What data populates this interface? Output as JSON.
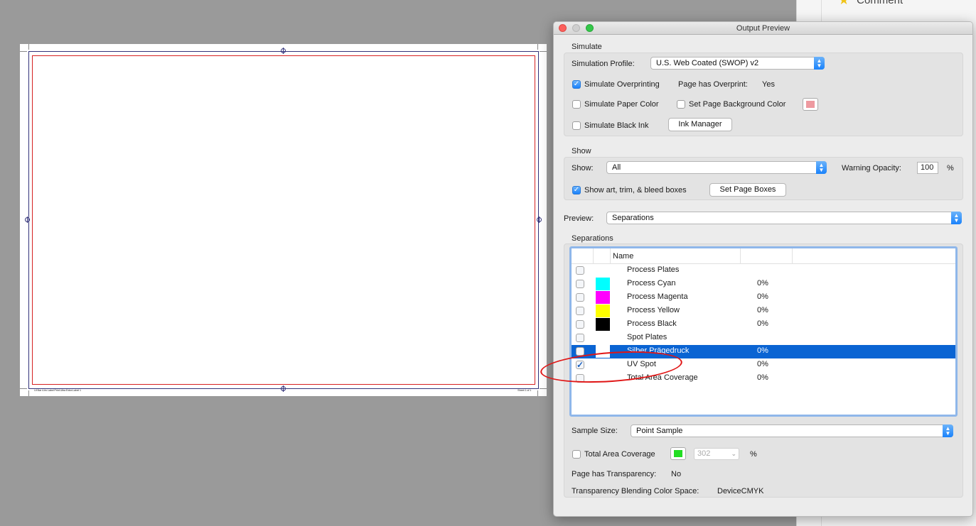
{
  "side_panel": {
    "comment_label": "Comment"
  },
  "page": {
    "slug_left": "UI Bar 4-fw Label Print Ultra Extra Label 1",
    "slug_right": "Sheet 1 of 1"
  },
  "dialog": {
    "title": "Output Preview",
    "simulate": {
      "section_label": "Simulate",
      "profile_label": "Simulation Profile:",
      "profile_value": "U.S. Web Coated (SWOP) v2",
      "overprinting_label": "Simulate Overprinting",
      "overprinting_checked": true,
      "overprint_status_label": "Page has Overprint:",
      "overprint_status_value": "Yes",
      "paper_color_label": "Simulate Paper Color",
      "bg_color_label": "Set Page Background Color",
      "bg_color_swatch": "#ee9aa0",
      "black_ink_label": "Simulate Black Ink",
      "ink_manager_button": "Ink Manager"
    },
    "show": {
      "section_label": "Show",
      "show_label": "Show:",
      "show_value": "All",
      "warning_opacity_label": "Warning Opacity:",
      "warning_opacity_value": "100",
      "percent": "%",
      "boxes_label": "Show art, trim, & bleed boxes",
      "boxes_checked": true,
      "set_page_boxes_button": "Set Page Boxes"
    },
    "preview": {
      "label": "Preview:",
      "value": "Separations"
    },
    "separations": {
      "section_label": "Separations",
      "column_name": "Name",
      "rows": [
        {
          "name": "Process Plates",
          "color": "",
          "percent": "",
          "checked": false,
          "selected": false
        },
        {
          "name": "Process Cyan",
          "color": "#00ffff",
          "percent": "0%",
          "checked": false,
          "selected": false
        },
        {
          "name": "Process Magenta",
          "color": "#ff00ff",
          "percent": "0%",
          "checked": false,
          "selected": false
        },
        {
          "name": "Process Yellow",
          "color": "#ffff00",
          "percent": "0%",
          "checked": false,
          "selected": false
        },
        {
          "name": "Process Black",
          "color": "#000000",
          "percent": "0%",
          "checked": false,
          "selected": false
        },
        {
          "name": "Spot Plates",
          "color": "",
          "percent": "",
          "checked": false,
          "selected": false
        },
        {
          "name": "Silber Prägedruck",
          "color": "#ffffff",
          "percent": "0%",
          "checked": false,
          "selected": true
        },
        {
          "name": "UV Spot",
          "color": "",
          "percent": "0%",
          "checked": true,
          "selected": false
        },
        {
          "name": "Total Area Coverage",
          "color": "",
          "percent": "0%",
          "checked": false,
          "selected": false
        }
      ]
    },
    "sample_size": {
      "label": "Sample Size:",
      "value": "Point Sample"
    },
    "coverage": {
      "label": "Total Area Coverage",
      "swatch_color": "#22dd22",
      "value": "302",
      "percent": "%"
    },
    "transparency": {
      "label": "Page has Transparency:",
      "value": "No",
      "blend_label": "Transparency Blending Color Space:",
      "blend_value": "DeviceCMYK"
    }
  }
}
